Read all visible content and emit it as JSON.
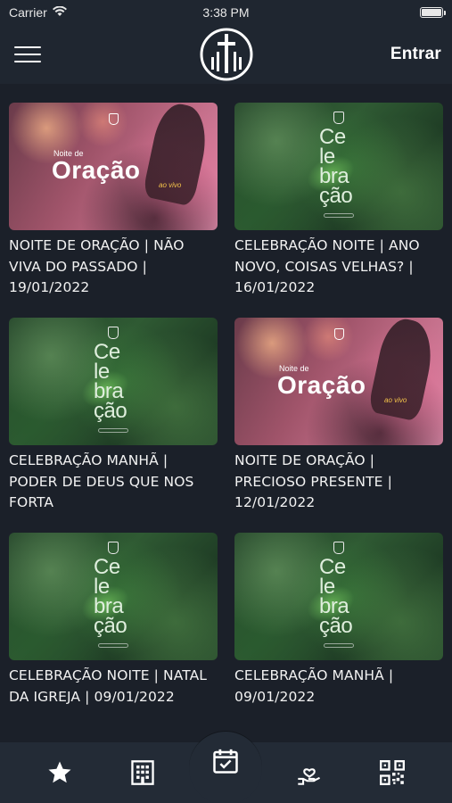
{
  "status_bar": {
    "carrier": "Carrier",
    "time": "3:38 PM"
  },
  "header": {
    "login_label": "Entrar",
    "logo_icon": "church-cross-logo-icon"
  },
  "posts": [
    {
      "title": "NOITE DE ORAÇÃO | NÃO VIVA DO PASSADO | 19/01/2022",
      "thumbnail": "oracao"
    },
    {
      "title": "CELEBRAÇÃO NOITE | ANO NOVO, COISAS VELHAS? | 16/01/2022",
      "thumbnail": "celebracao"
    },
    {
      "title": "CELEBRAÇÃO MANHÃ | PODER DE DEUS QUE NOS FORTA",
      "thumbnail": "celebracao"
    },
    {
      "title": "NOITE DE ORAÇÃO | PRECIOSO PRESENTE | 12/01/2022",
      "thumbnail": "oracao"
    },
    {
      "title": "CELEBRAÇÃO NOITE | NATAL DA IGREJA | 09/01/2022",
      "thumbnail": "celebracao"
    },
    {
      "title": "CELEBRAÇÃO MANHÃ | 09/01/2022",
      "thumbnail": "celebracao"
    }
  ],
  "thumb_text": {
    "celebracao": "Ce\nle\nbra\nção",
    "oracao_small": "Noite de",
    "oracao_big": "Oração",
    "oracao_sub": "ao vivo"
  },
  "bottom_nav": [
    {
      "icon": "star-icon"
    },
    {
      "icon": "building-icon"
    },
    {
      "icon": "calendar-check-icon"
    },
    {
      "icon": "hand-heart-icon"
    },
    {
      "icon": "qr-code-icon"
    }
  ],
  "colors": {
    "background": "#1b2029",
    "header": "#1f2630",
    "nav": "#232b36",
    "text": "#f2f2f2"
  }
}
